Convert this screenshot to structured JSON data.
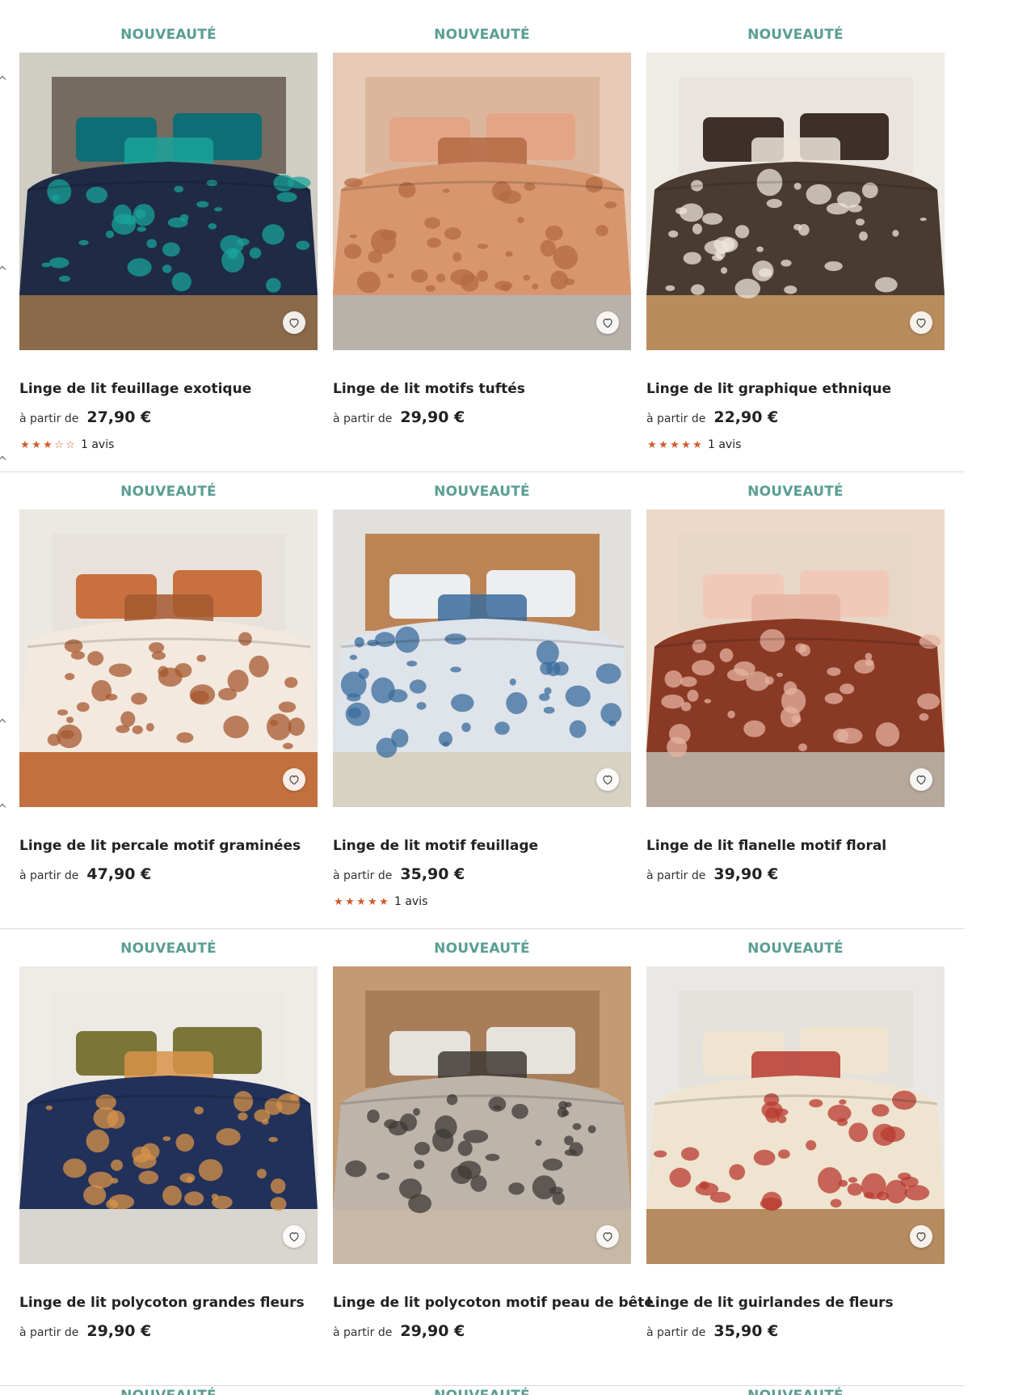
{
  "products": [
    {
      "badge": "NOUVEAUTÉ",
      "title": "Linge de lit feuillage exotique",
      "from": "à partir de",
      "price": "27,90 €",
      "stars": 3,
      "reviews": "1 avis",
      "image": {
        "bg": "#6b6055",
        "wall": "#cfcdc4",
        "duvet": "#1f2b45",
        "accent": "#1aa39a",
        "pillow": "#0f6d75",
        "floor": "#8a6a4a"
      }
    },
    {
      "badge": "NOUVEAUTÉ",
      "title": "Linge de lit motifs tuftés",
      "from": "à partir de",
      "price": "29,90 €",
      "stars": 0,
      "reviews": "",
      "image": {
        "bg": "#d9b49a",
        "wall": "#e7cbb6",
        "duvet": "#d8966f",
        "accent": "#b46a43",
        "pillow": "#e3a585",
        "floor": "#b9b2ab"
      }
    },
    {
      "badge": "NOUVEAUTÉ",
      "title": "Linge de lit graphique ethnique",
      "from": "à partir de",
      "price": "22,90 €",
      "stars": 5,
      "reviews": "1 avis",
      "image": {
        "bg": "#e8e3dc",
        "wall": "#efebe5",
        "duvet": "#4a3b30",
        "accent": "#efe6da",
        "pillow": "#3e3028",
        "floor": "#b98c5e"
      }
    },
    {
      "badge": "NOUVEAUTÉ",
      "title": "Linge de lit percale motif graminées",
      "from": "à partir de",
      "price": "47,90 €",
      "stars": 0,
      "reviews": "",
      "image": {
        "bg": "#e7e2db",
        "wall": "#ece8e2",
        "duvet": "#f3e9df",
        "accent": "#a5582f",
        "pillow": "#c8713f",
        "floor": "#c2703e"
      }
    },
    {
      "badge": "NOUVEAUTÉ",
      "title": "Linge de lit motif feuillage",
      "from": "à partir de",
      "price": "35,90 €",
      "stars": 5,
      "reviews": "1 avis",
      "image": {
        "bg": "#b87a45",
        "wall": "#e2e0dc",
        "duvet": "#dfe3ea",
        "accent": "#3a6c9c",
        "pillow": "#eceef0",
        "floor": "#d8d2c3"
      }
    },
    {
      "badge": "NOUVEAUTÉ",
      "title": "Linge de lit flanelle motif floral",
      "from": "à partir de",
      "price": "39,90 €",
      "stars": 0,
      "reviews": "",
      "image": {
        "bg": "#e8d6c6",
        "wall": "#ecd9c8",
        "duvet": "#8a3a24",
        "accent": "#e6b3a0",
        "pillow": "#f0c9b8",
        "floor": "#b6a89a"
      }
    },
    {
      "badge": "NOUVEAUTÉ",
      "title": "Linge de lit polycoton grandes fleurs",
      "from": "à partir de",
      "price": "29,90 €",
      "stars": 0,
      "reviews": "",
      "image": {
        "bg": "#ece9e4",
        "wall": "#efece7",
        "duvet": "#22315a",
        "accent": "#d8934a",
        "pillow": "#7b7637",
        "floor": "#d9d6cf"
      }
    },
    {
      "badge": "NOUVEAUTÉ",
      "title": "Linge de lit polycoton motif peau de bête",
      "from": "à partir de",
      "price": "29,90 €",
      "stars": 0,
      "reviews": "",
      "image": {
        "bg": "#a67a55",
        "wall": "#c49a72",
        "duvet": "#bdb4aa",
        "accent": "#3e3935",
        "pillow": "#e6e3de",
        "floor": "#c8b9a7"
      }
    },
    {
      "badge": "NOUVEAUTÉ",
      "title": "Linge de lit guirlandes de fleurs",
      "from": "à partir de",
      "price": "35,90 €",
      "stars": 0,
      "reviews": "",
      "image": {
        "bg": "#e4e1dc",
        "wall": "#eae8e5",
        "duvet": "#eee4cf",
        "accent": "#b83a2f",
        "pillow": "#efe4cf",
        "floor": "#b58b5f"
      }
    }
  ],
  "next_row_badges": [
    "NOUVEAUTÉ",
    "NOUVEAUTÉ",
    "NOUVEAUTÉ"
  ],
  "colors": {
    "badge": "#5a9e93",
    "star": "#d35a28",
    "separator": "#d9d9d9"
  }
}
